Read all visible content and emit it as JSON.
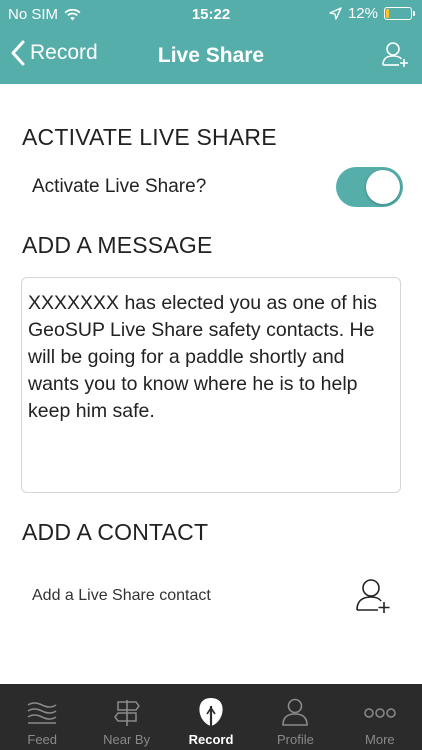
{
  "status_bar": {
    "carrier": "No SIM",
    "time": "15:22",
    "battery_percent": "12%",
    "battery_level": 0.12,
    "icons": [
      "wifi-icon",
      "location-arrow-icon",
      "battery-icon"
    ]
  },
  "nav": {
    "back_label": "Record",
    "title": "Live Share",
    "right_icon": "add-user-icon"
  },
  "activate": {
    "section_title": "ACTIVATE LIVE SHARE",
    "toggle_label": "Activate Live Share?",
    "toggle_on": true
  },
  "message": {
    "section_title": "ADD A MESSAGE",
    "text": "XXXXXXX has elected you as one of his GeoSUP Live Share safety contacts. He will be going for a paddle shortly and wants you to know where he is to help keep him safe."
  },
  "contact": {
    "section_title": "ADD A CONTACT",
    "add_label": "Add a Live Share contact",
    "icon": "add-user-icon"
  },
  "tabs": [
    {
      "label": "Feed",
      "icon": "feed-icon",
      "active": false
    },
    {
      "label": "Near By",
      "icon": "signpost-icon",
      "active": false
    },
    {
      "label": "Record",
      "icon": "paddle-icon",
      "active": true
    },
    {
      "label": "Profile",
      "icon": "profile-icon",
      "active": false
    },
    {
      "label": "More",
      "icon": "more-icon",
      "active": false
    }
  ],
  "colors": {
    "accent": "#56aeaa",
    "tabbar": "#2b2b2b",
    "battery_low": "#f4c531"
  }
}
